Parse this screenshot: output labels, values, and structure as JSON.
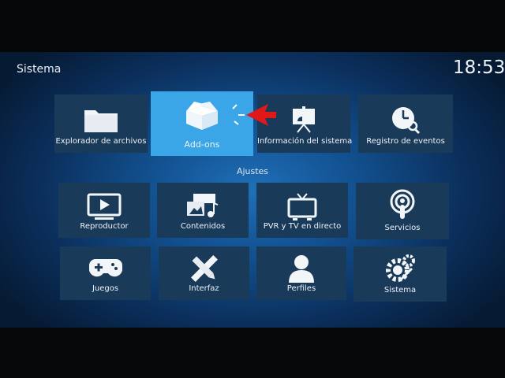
{
  "header": {
    "title": "Sistema",
    "clock": "18:53"
  },
  "section_label": "Ajustes",
  "top_tiles": [
    {
      "label": "Explorador de archivos",
      "icon": "folder-icon"
    },
    {
      "label": "Add-ons",
      "icon": "open-box-icon"
    },
    {
      "label": "Información del sistema",
      "icon": "presentation-icon"
    },
    {
      "label": "Registro de eventos",
      "icon": "clock-search-icon"
    }
  ],
  "settings_tiles": [
    {
      "label": "Reproductor",
      "icon": "monitor-play-icon"
    },
    {
      "label": "Contenidos",
      "icon": "media-library-icon"
    },
    {
      "label": "PVR y TV en directo",
      "icon": "tv-icon"
    },
    {
      "label": "Servicios",
      "icon": "podcast-icon"
    },
    {
      "label": "Juegos",
      "icon": "gamepad-icon"
    },
    {
      "label": "Interfaz",
      "icon": "pencil-ruler-icon"
    },
    {
      "label": "Perfiles",
      "icon": "user-icon"
    },
    {
      "label": "Sistema",
      "icon": "gears-icon"
    }
  ],
  "colors": {
    "focus": "#3aa6e8",
    "tile": "#1a3a5a",
    "arrow": "#e01818"
  }
}
